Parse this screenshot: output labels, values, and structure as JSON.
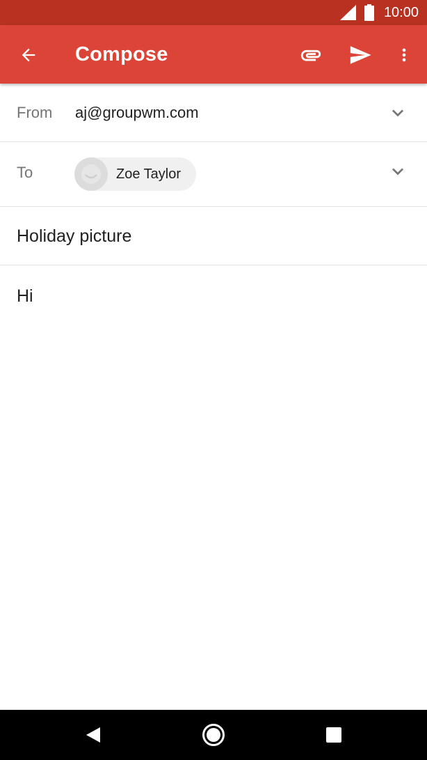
{
  "status_bar": {
    "time": "10:00",
    "icons": [
      "cell-signal-icon",
      "battery-icon"
    ]
  },
  "app_bar": {
    "title": "Compose",
    "icons": [
      "back-arrow-icon",
      "paperclip-icon",
      "send-icon",
      "more-vert-icon"
    ]
  },
  "from": {
    "label": "From",
    "value": "aj@groupwm.com"
  },
  "to": {
    "label": "To",
    "recipient": "Zoe Taylor"
  },
  "subject": {
    "value": "Holiday picture"
  },
  "body": {
    "value": "Hi"
  },
  "nav_bar": {
    "icons": [
      "nav-back-icon",
      "nav-home-icon",
      "nav-recents-icon"
    ]
  },
  "colors": {
    "app_bar": "#db4437",
    "status_bar": "#b93221",
    "divider": "#e3e3e3",
    "chip": "#f0f0f0",
    "nav_bar": "#000000"
  }
}
